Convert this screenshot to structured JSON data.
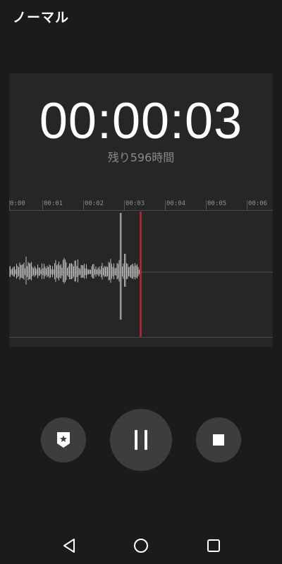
{
  "header": {
    "mode_title": "ノーマル"
  },
  "recorder": {
    "elapsed_time": "00:00:03",
    "remaining_label": "残り596時間"
  },
  "timeline": {
    "ticks": [
      "0:00",
      "00:01",
      "00:02",
      "00:03",
      "00:04",
      "00:05",
      "00:06"
    ]
  },
  "controls": {
    "bookmark_icon": "bookmark-star-icon",
    "pause_icon": "pause-icon",
    "stop_icon": "stop-icon"
  },
  "navbar": {
    "back_icon": "back-triangle-icon",
    "home_icon": "home-circle-icon",
    "recent_icon": "recent-square-icon"
  },
  "colors": {
    "background": "#1b1b1b",
    "panel": "#262626",
    "button": "#3d3d3d",
    "playhead": "#c0272d",
    "waveform": "#bdbdbd"
  }
}
